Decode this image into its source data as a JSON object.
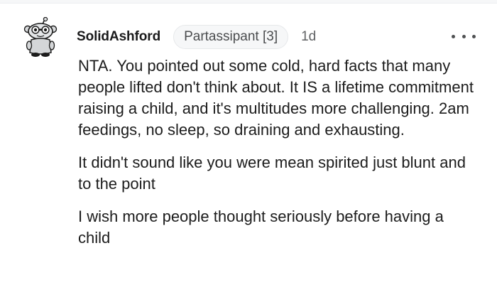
{
  "comment": {
    "username": "SolidAshford",
    "flair": "Partassipant [3]",
    "age": "1d",
    "more_icon": "more-dots-icon",
    "avatar_icon": "snoo-avatar-icon",
    "paragraphs": [
      "NTA. You pointed out some cold, hard facts that many people lifted don't think about. It IS a lifetime commitment raising a child, and it's multitudes more challenging. 2am feedings, no sleep, so draining and exhausting.",
      "It didn't sound like you were mean spirited just blunt and to the point",
      "I wish more people thought seriously before having a child"
    ]
  },
  "colors": {
    "text": "#1c1c1c",
    "flair_bg": "#f6f7f8",
    "secondary_text": "#5f6163"
  }
}
